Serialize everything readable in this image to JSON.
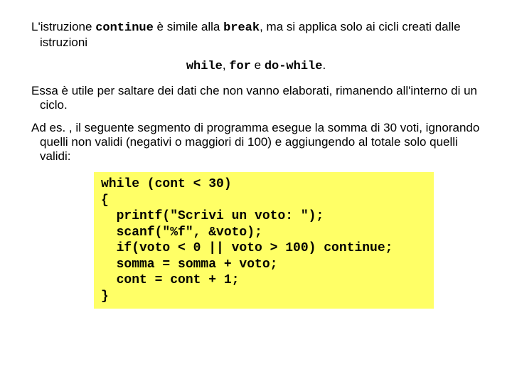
{
  "p1": {
    "t1": "L'istruzione ",
    "kw1": "continue",
    "t2": " è simile alla ",
    "kw2": "break",
    "t3": ", ma si applica solo ai cicli creati dalle istruzioni"
  },
  "p1c": {
    "kw1": "while",
    "t1": ", ",
    "kw2": "for",
    "t2": " e ",
    "kw3": "do-while",
    "t3": "."
  },
  "p2": "Essa è utile per saltare dei dati che non vanno elaborati, rimanendo all'interno di un ciclo.",
  "p3": "Ad es. , il seguente segmento di programma esegue la somma di 30 voti, ignorando quelli non validi (negativi o maggiori di 100) e aggiungendo al totale solo quelli validi:",
  "code": "while (cont < 30)\n{\n  printf(\"Scrivi un voto: \");\n  scanf(\"%f\", &voto);\n  if(voto < 0 || voto > 100) continue;\n  somma = somma + voto;\n  cont = cont + 1;\n}"
}
